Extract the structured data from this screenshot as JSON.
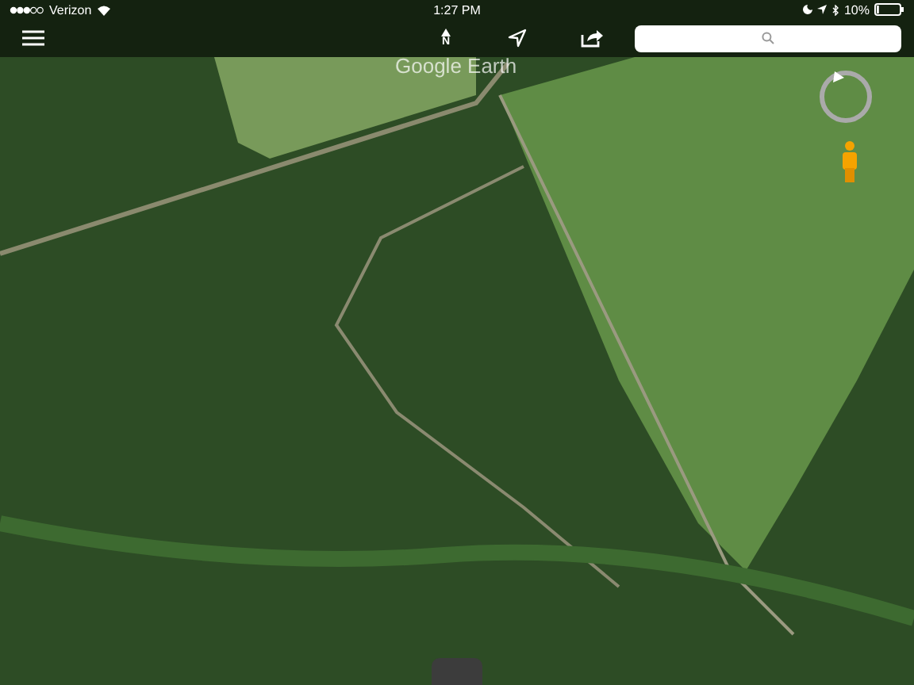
{
  "status_bar": {
    "carrier": "Verizon",
    "time": "1:27 PM",
    "battery": "10%"
  },
  "toolbar": {
    "north_label": "N"
  },
  "map": {
    "attribution": "Google Earth"
  }
}
